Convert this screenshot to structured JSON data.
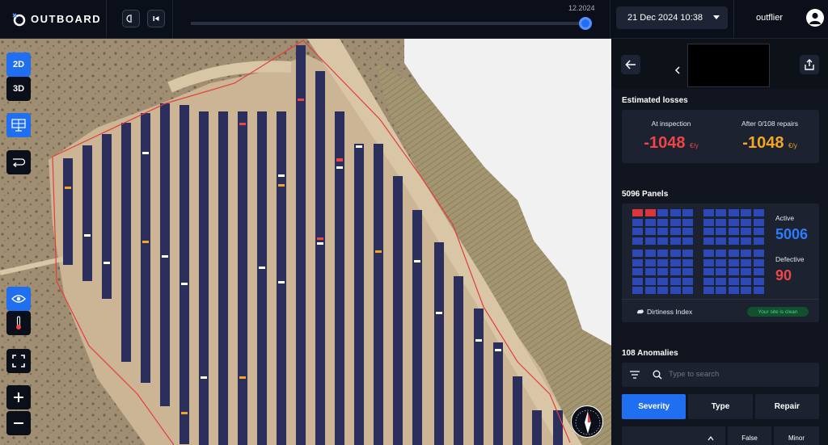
{
  "app": {
    "logo_text": "OUTBOARD"
  },
  "topbar": {
    "timeline_label": "12.2024",
    "date_value": "21 Dec 2024 10:38",
    "user_name": "outflier"
  },
  "map": {
    "tools": {
      "view_2d_label": "2D",
      "view_3d_label": "3D"
    }
  },
  "panel": {
    "estimated_losses": {
      "title": "Estimated losses",
      "at_inspection_label": "At inspection",
      "at_inspection_value": "-1048",
      "at_inspection_unit": "€/y",
      "after_repairs_label": "After 0/108 repairs",
      "after_repairs_value": "-1048",
      "after_repairs_unit": "€/y"
    },
    "panels": {
      "title": "5096 Panels",
      "active_label": "Active",
      "active_value": "5006",
      "defective_label": "Defective",
      "defective_value": "90",
      "dirtiness_label": "Dirtiness Index",
      "dirtiness_badge": "Your site is clean"
    },
    "anomalies": {
      "title": "108 Anomalies",
      "search_placeholder": "Type to search",
      "tabs": [
        {
          "label": "Severity"
        },
        {
          "label": "Type"
        },
        {
          "label": "Repair"
        }
      ],
      "filters": [
        {
          "label": ""
        },
        {
          "label": "False"
        },
        {
          "label": "Minor"
        }
      ]
    }
  },
  "colors": {
    "accent": "#1f6ff0",
    "loss_red": "#ef4545",
    "loss_orange": "#f5a524",
    "active_blue": "#2f7bff",
    "defective_red": "#ef4545",
    "panel_blue": "#2d49b8"
  }
}
